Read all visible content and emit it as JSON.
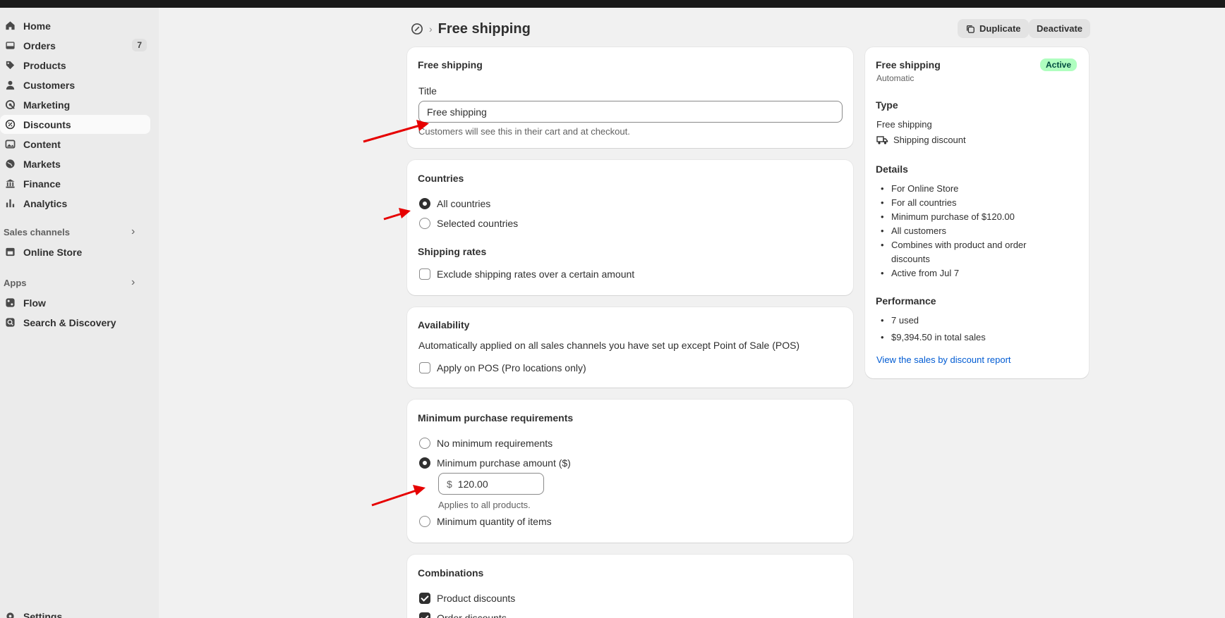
{
  "sidebar": {
    "items": [
      {
        "label": "Home",
        "icon": "home-icon"
      },
      {
        "label": "Orders",
        "icon": "inbox-icon",
        "badge": "7"
      },
      {
        "label": "Products",
        "icon": "tag-icon"
      },
      {
        "label": "Customers",
        "icon": "person-icon"
      },
      {
        "label": "Marketing",
        "icon": "target-icon"
      },
      {
        "label": "Discounts",
        "icon": "discount-icon"
      },
      {
        "label": "Content",
        "icon": "image-icon"
      },
      {
        "label": "Markets",
        "icon": "globe-icon"
      },
      {
        "label": "Finance",
        "icon": "bank-icon"
      },
      {
        "label": "Analytics",
        "icon": "bar-chart-icon"
      }
    ],
    "sales_channels_label": "Sales channels",
    "online_store_label": "Online Store",
    "apps_label": "Apps",
    "flow_label": "Flow",
    "search_discovery_label": "Search & Discovery",
    "settings_label": "Settings"
  },
  "header": {
    "title": "Free shipping",
    "duplicate_label": "Duplicate",
    "deactivate_label": "Deactivate"
  },
  "title_card": {
    "heading": "Free shipping",
    "field_label": "Title",
    "field_value": "Free shipping",
    "help": "Customers will see this in their cart and at checkout."
  },
  "countries_card": {
    "heading": "Countries",
    "all_label": "All countries",
    "selected_label": "Selected countries",
    "rates_heading": "Shipping rates",
    "exclude_label": "Exclude shipping rates over a certain amount",
    "selected_option": "All countries"
  },
  "availability_card": {
    "heading": "Availability",
    "description": "Automatically applied on all sales channels you have set up except Point of Sale (POS)",
    "pos_label": "Apply on POS (Pro locations only)"
  },
  "minimum_card": {
    "heading": "Minimum purchase requirements",
    "none_label": "No minimum requirements",
    "amount_label": "Minimum purchase amount ($)",
    "currency_prefix": "$",
    "amount_value": "120.00",
    "applies_text": "Applies to all products.",
    "quantity_label": "Minimum quantity of items",
    "selected_option": "Minimum purchase amount ($)"
  },
  "combinations_card": {
    "heading": "Combinations",
    "product_label": "Product discounts",
    "order_label": "Order discounts"
  },
  "summary": {
    "title": "Free shipping",
    "subtitle": "Automatic",
    "status": "Active",
    "type_heading": "Type",
    "type_value": "Free shipping",
    "type_sub": "Shipping discount",
    "details_heading": "Details",
    "details": [
      "For Online Store",
      "For all countries",
      "Minimum purchase of $120.00",
      "All customers",
      "Combines with product and order",
      "discounts",
      "Active from Jul 7"
    ],
    "performance_heading": "Performance",
    "performance": [
      "7 used",
      "$9,394.50 in total sales"
    ],
    "report_link": "View the sales by discount report"
  },
  "colors": {
    "annotation_arrow": "#e60000",
    "active_badge_bg": "#affebf",
    "link": "#005bd3"
  }
}
